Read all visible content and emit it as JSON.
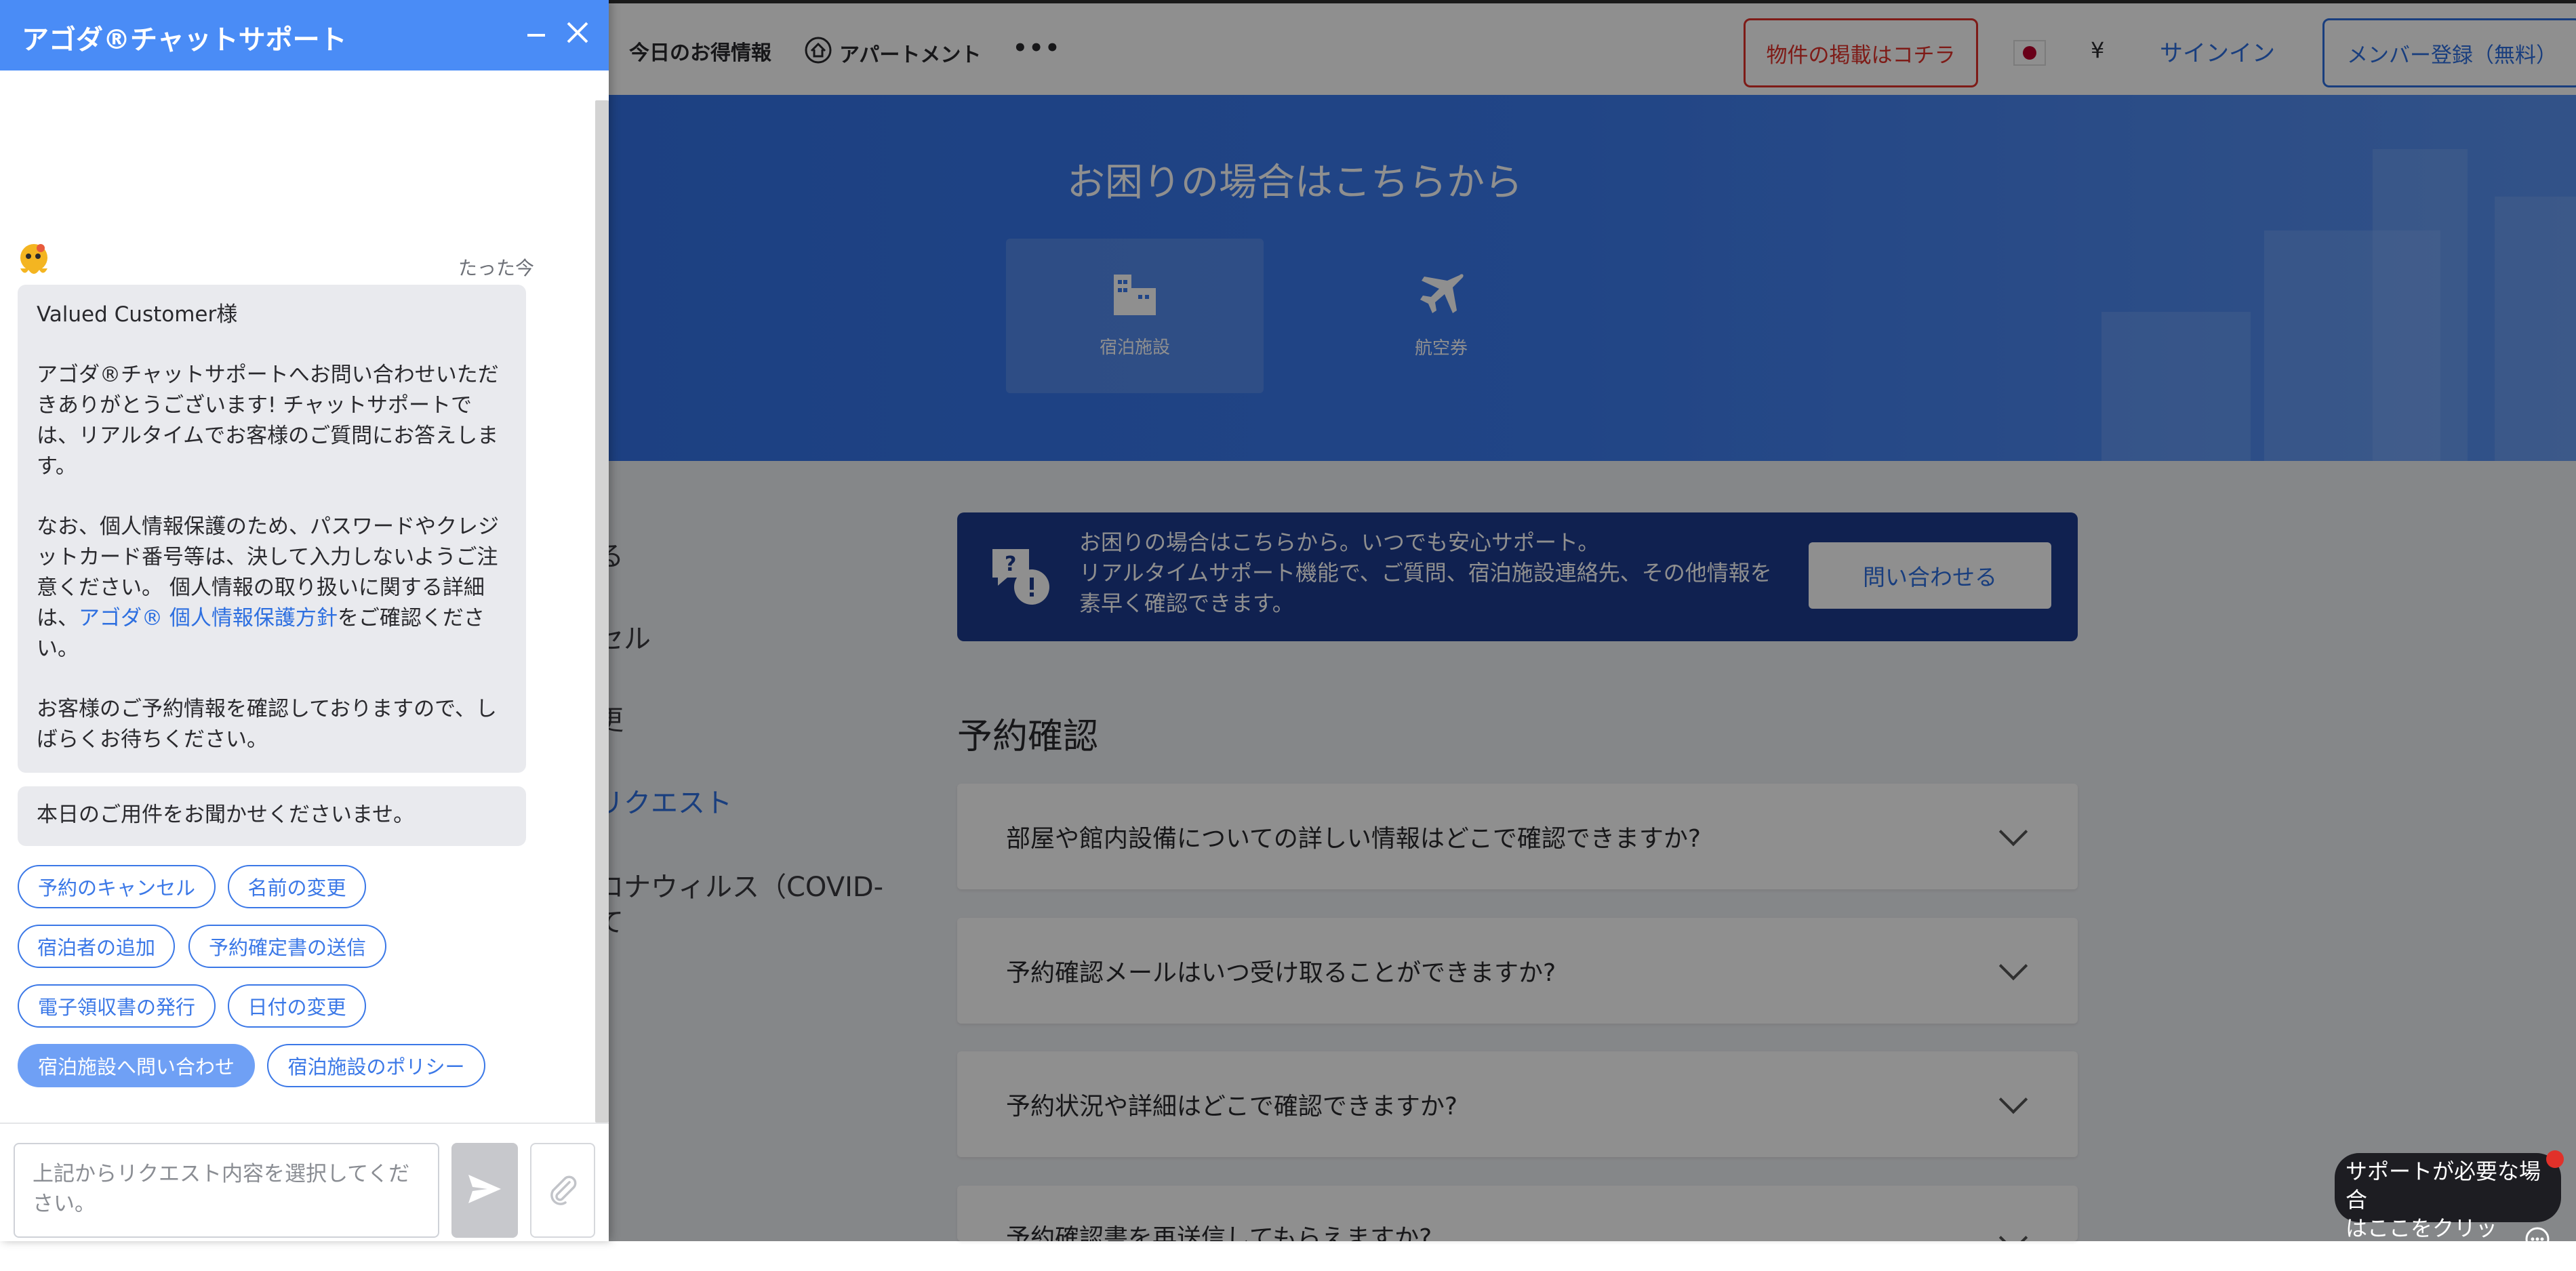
{
  "header": {
    "nav": [
      "今日のお得情報",
      "アパートメント",
      "•••"
    ],
    "list_property": "物件の掲載はコチラ",
    "currency": "¥",
    "signin": "サインイン",
    "register": "メンバー登録（無料）"
  },
  "hero": {
    "title": "お困りの場合はこちらから",
    "tabs": [
      "宿泊施設",
      "航空券"
    ]
  },
  "sidenav": {
    "items": [
      "る",
      "セル",
      "更",
      "リクエスト",
      "ロナウィルス（COVID-",
      "て"
    ]
  },
  "banner": {
    "line1": "お困りの場合はこちらから。いつでも安心サポート。",
    "line2": "リアルタイムサポート機能で、ご質問、宿泊施設連絡先、その他情報を素早く確認できます。",
    "button": "問い合わせる"
  },
  "faq": {
    "title": "予約確認",
    "items": [
      "部屋や館内設備についての詳しい情報はどこで確認できますか?",
      "予約確認メールはいつ受け取ることができますか?",
      "予約状況や詳細はどこで確認できますか?",
      "予約確認書を再送信してもらえますか?"
    ]
  },
  "help_bubble": {
    "line1": "サポートが必要な場合",
    "line2": "はここをクリック"
  },
  "chat": {
    "title": "アゴダ®チャットサポート",
    "timestamp": "たった今",
    "greeting": "Valued Customer様",
    "para1": "アゴダ®チャットサポートへお問い合わせいただきありがとうございます! チャットサポートでは、リアルタイムでお客様のご質問にお答えします。",
    "para2_pre": "なお、個人情報保護のため、パスワードやクレジットカード番号等は、決して入力しないようご注意ください。 個人情報の取り扱いに関する詳細は、",
    "para2_link": "アゴダ® 個人情報保護方針",
    "para2_post": "をご確認ください。",
    "para3": "お客様のご予約情報を確認しておりますので、しばらくお待ちください。",
    "question": "本日のご用件をお聞かせくださいませ。",
    "quick_replies": [
      "予約のキャンセル",
      "名前の変更",
      "宿泊者の追加",
      "予約確定書の送信",
      "電子領収書の発行",
      "日付の変更",
      "宿泊施設へ問い合わせ",
      "宿泊施設のポリシー"
    ],
    "input_placeholder": "上記からリクエスト内容を選択してください。"
  },
  "colors": {
    "accent": "#4a8cf6",
    "brand_red": "#e1312a",
    "banner": "#1e3b8f"
  }
}
